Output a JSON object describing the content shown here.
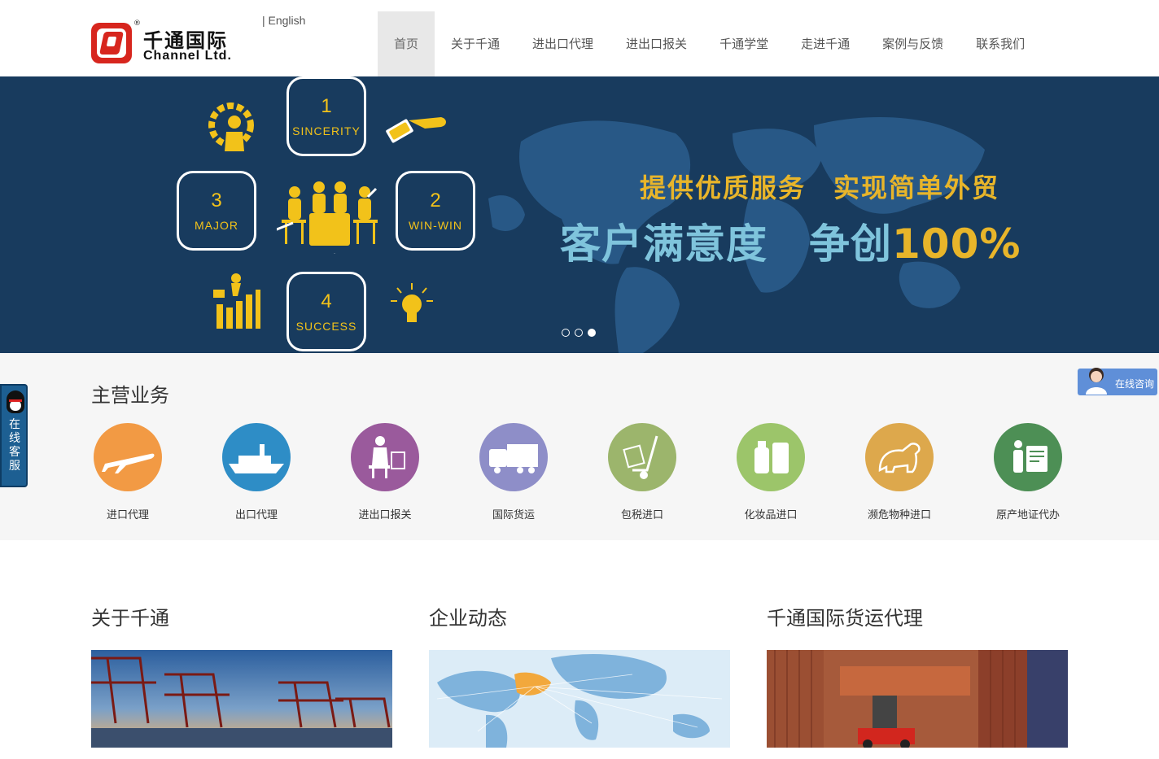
{
  "header": {
    "logo_cn": "千通国际",
    "logo_en": "Channel Ltd.",
    "logo_reg": "®",
    "lang_link": "| English",
    "nav": [
      {
        "label": "首页",
        "active": true
      },
      {
        "label": "关于千通",
        "active": false
      },
      {
        "label": "进出口代理",
        "active": false
      },
      {
        "label": "进出口报关",
        "active": false
      },
      {
        "label": "千通学堂",
        "active": false
      },
      {
        "label": "走进千通",
        "active": false
      },
      {
        "label": "案例与反馈",
        "active": false
      },
      {
        "label": "联系我们",
        "active": false
      }
    ]
  },
  "banner": {
    "bubbles": [
      {
        "num": "1",
        "word": "SINCERITY"
      },
      {
        "num": "2",
        "word": "WIN-WIN"
      },
      {
        "num": "3",
        "word": "MAJOR"
      },
      {
        "num": "4",
        "word": "SUCCESS"
      }
    ],
    "slogan_line1": "提供优质服务　实现简单外贸",
    "slogan_line2": "客户满意度　争创",
    "slogan_pct": "100%",
    "active_slide": 3,
    "slide_count": 3
  },
  "services": {
    "title": "主营业务",
    "items": [
      {
        "label": "进口代理",
        "color": "#f29a44",
        "icon": "airplane-icon"
      },
      {
        "label": "出口代理",
        "color": "#2e8dc6",
        "icon": "ship-icon"
      },
      {
        "label": "进出口报关",
        "color": "#9a5a9c",
        "icon": "customs-officer-icon"
      },
      {
        "label": "国际货运",
        "color": "#8e8ec8",
        "icon": "truck-icon"
      },
      {
        "label": "包税进口",
        "color": "#9cb56c",
        "icon": "hand-truck-icon"
      },
      {
        "label": "化妆品进口",
        "color": "#9cc56a",
        "icon": "cosmetics-icon"
      },
      {
        "label": "濒危物种进口",
        "color": "#dda84c",
        "icon": "polar-bear-icon"
      },
      {
        "label": "原产地证代办",
        "color": "#4d8f55",
        "icon": "certificate-icon"
      }
    ]
  },
  "side_widget": {
    "label": "在线客服"
  },
  "online_consult": {
    "label": "在线咨询"
  },
  "columns": [
    {
      "title": "关于千通"
    },
    {
      "title": "企业动态"
    },
    {
      "title": "千通国际货运代理"
    }
  ]
}
